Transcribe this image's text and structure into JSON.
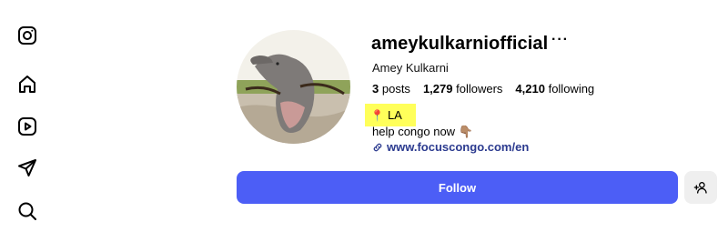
{
  "sidebar": {
    "items": [
      {
        "icon": "instagram-icon"
      },
      {
        "icon": "home-icon"
      },
      {
        "icon": "reels-icon"
      },
      {
        "icon": "send-icon"
      },
      {
        "icon": "search-icon"
      }
    ]
  },
  "profile": {
    "username": "ameykulkarniofficial",
    "more_label": "···",
    "full_name": "Amey Kulkarni",
    "stats": {
      "posts_count": "3",
      "posts_label": "posts",
      "followers_count": "1,279",
      "followers_label": "followers",
      "following_count": "4,210",
      "following_label": "following"
    },
    "location": "LA",
    "bio": "help congo now 👇🏽",
    "link": "www.focuscongo.com/en",
    "follow_label": "Follow"
  },
  "colors": {
    "accent": "#4c5ef6",
    "highlight": "#ffff5a",
    "link": "#2b3a8f"
  }
}
